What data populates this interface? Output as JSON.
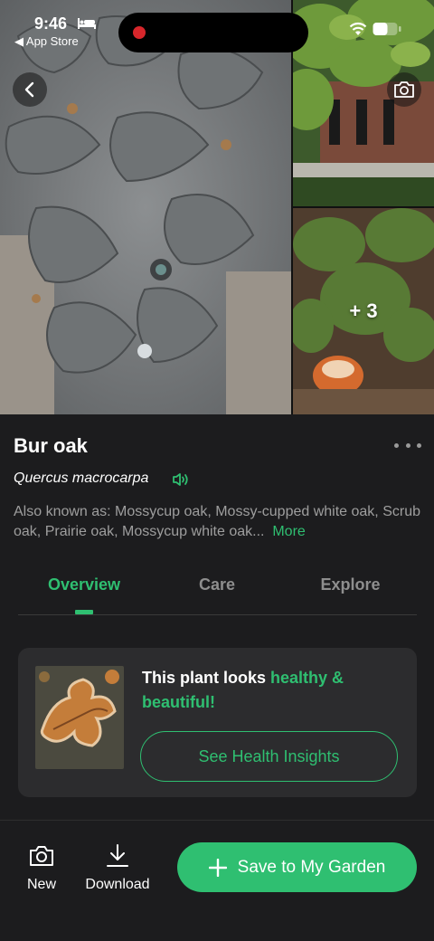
{
  "status_bar": {
    "time": "9:46",
    "back_app_label": "◀ App Store"
  },
  "gallery": {
    "more_count": "+ 3"
  },
  "plant": {
    "common_name": "Bur oak",
    "scientific_name": "Quercus macrocarpa",
    "also_known_as": "Also known as: Mossycup oak, Mossy-cupped white oak, Scrub oak, Prairie oak, Mossycup white oak...",
    "more_label": "More"
  },
  "tabs": [
    {
      "label": "Overview",
      "active": true
    },
    {
      "label": "Care",
      "active": false
    },
    {
      "label": "Explore",
      "active": false
    }
  ],
  "health": {
    "text_prefix": "This plant looks ",
    "text_accent": "healthy & beautiful!",
    "button_label": "See Health Insights"
  },
  "bottom_bar": {
    "new_label": "New",
    "download_label": "Download",
    "save_label": "Save to My Garden"
  },
  "colors": {
    "accent": "#2fbf71",
    "background": "#1c1c1e",
    "card": "#2c2c2e",
    "recording": "#d7262b"
  },
  "icons": [
    "bed-icon",
    "wifi-icon",
    "battery-icon",
    "back-chevron-icon",
    "camera-icon",
    "speaker-icon",
    "more-dots-icon",
    "download-icon",
    "plus-icon"
  ]
}
